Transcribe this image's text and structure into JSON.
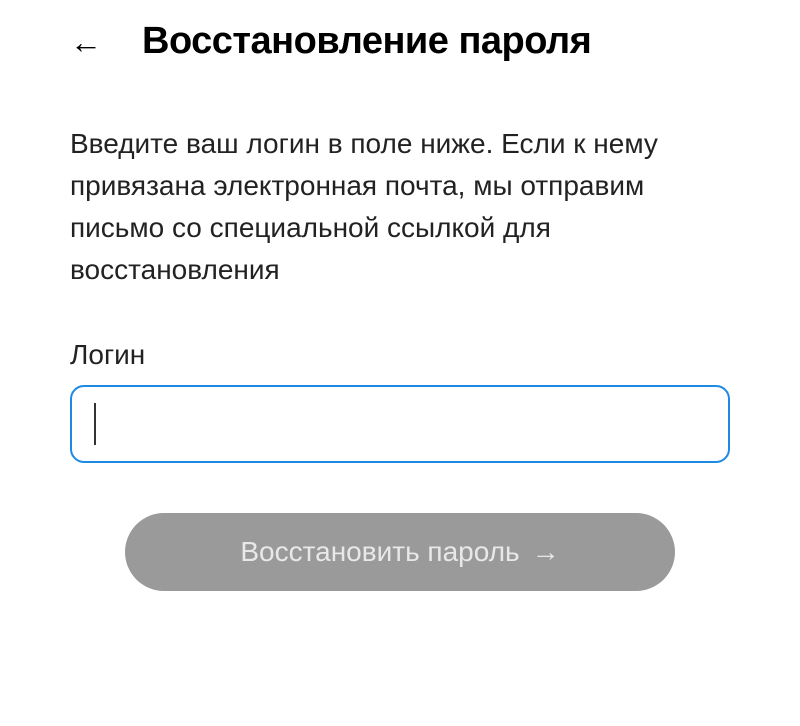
{
  "header": {
    "title": "Восстановление пароля"
  },
  "description": "Введите ваш логин в поле ниже. Если к нему привязана электронная почта, мы отправим письмо со специальной ссылкой для восстановления",
  "form": {
    "login_label": "Логин",
    "login_value": "",
    "submit_label": "Восстановить пароль"
  }
}
